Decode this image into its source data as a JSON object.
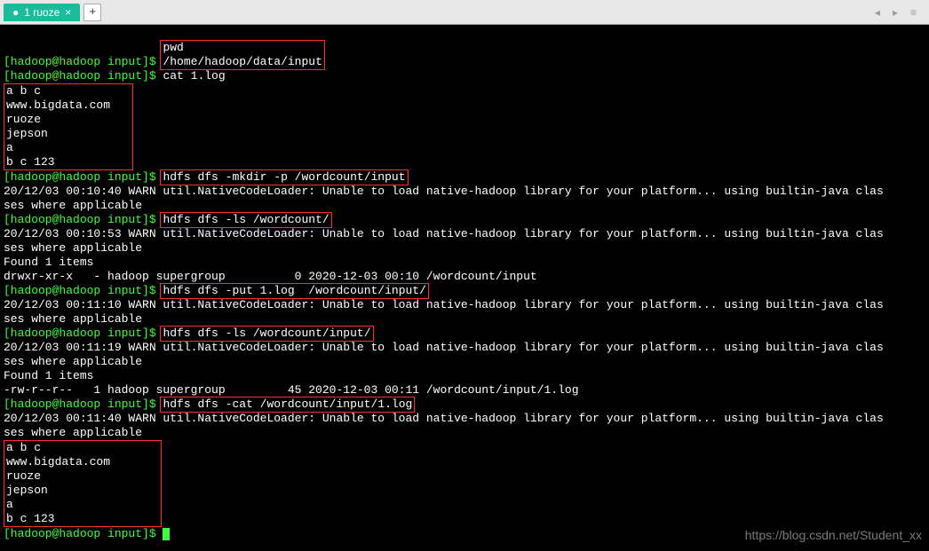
{
  "tabs": {
    "active_label": "1 ruoze",
    "close_glyph": "×",
    "add_glyph": "+"
  },
  "nav": {
    "left": "◂",
    "right": "▸",
    "menu": "≡"
  },
  "prompt": "[hadoop@hadoop input]$",
  "lines": {
    "cmd_pwd": "pwd",
    "pwd_out": "/home/hadoop/data/input",
    "cmd_cat": "cat 1.log",
    "file": {
      "l1": "a b c",
      "l2": "www.bigdata.com",
      "l3": "ruoze",
      "l4": "jepson",
      "l5": "a",
      "l6": "b c 123"
    },
    "cmd_mkdir": "hdfs dfs -mkdir -p /wordcount/input",
    "warn_mkdir_a": "20/12/03 00:10:40 WARN util.NativeCodeLoader: Unable to load native-hadoop library for your platform... using builtin-java clas",
    "warn_tail": "ses where applicable",
    "cmd_ls1": "hdfs dfs -ls /wordcount/",
    "warn_ls1_a": "20/12/03 00:10:53 WARN util.NativeCodeLoader: Unable to load native-hadoop library for your platform... using builtin-java clas",
    "found1": "Found 1 items",
    "ls1_out": "drwxr-xr-x   - hadoop supergroup          0 2020-12-03 00:10 /wordcount/input",
    "cmd_put": "hdfs dfs -put 1.log  /wordcount/input/",
    "warn_put_a": "20/12/03 00:11:10 WARN util.NativeCodeLoader: Unable to load native-hadoop library for your platform... using builtin-java clas",
    "cmd_ls2": "hdfs dfs -ls /wordcount/input/",
    "warn_ls2_a": "20/12/03 00:11:19 WARN util.NativeCodeLoader: Unable to load native-hadoop library for your platform... using builtin-java clas",
    "ls2_out": "-rw-r--r--   1 hadoop supergroup         45 2020-12-03 00:11 /wordcount/input/1.log",
    "cmd_cat2": "hdfs dfs -cat /wordcount/input/1.log",
    "warn_cat2_a": "20/12/03 00:11:40 WARN util.NativeCodeLoader: Unable to load native-hadoop library for your platform... using builtin-java clas"
  },
  "watermark": "https://blog.csdn.net/Student_xx"
}
